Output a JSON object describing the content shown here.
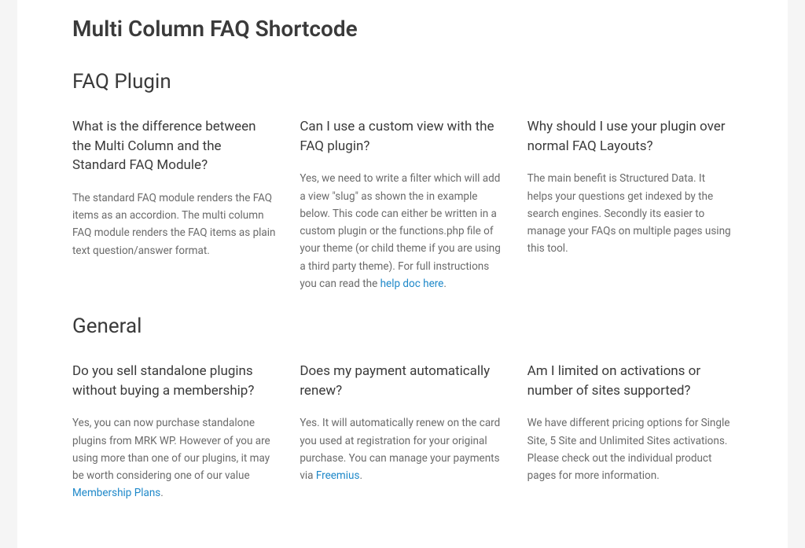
{
  "page": {
    "title": "Multi Column FAQ Shortcode"
  },
  "sections": [
    {
      "heading": "FAQ Plugin",
      "items": [
        {
          "question": "What is the difference between the Multi Column and the Standard FAQ Module?",
          "answer_before": "The standard FAQ module renders the FAQ items as an accordion. The multi column FAQ module renders the FAQ items as plain text question/answer format.",
          "link_text": "",
          "answer_after": ""
        },
        {
          "question": "Can I use a custom view with the FAQ plugin?",
          "answer_before": "Yes, we need to write a filter which will add a view \"slug\" as shown the in example below. This code can either be written in a custom plugin or the functions.php file of your theme (or child theme if you are using a third party theme). For full instructions you can read the ",
          "link_text": "help doc here",
          "answer_after": "."
        },
        {
          "question": "Why should I use your plugin over normal FAQ Layouts?",
          "answer_before": "The main benefit is Structured Data. It helps your questions get indexed by the search engines. Secondly its easier to manage your FAQs on multiple pages using this tool.",
          "link_text": "",
          "answer_after": ""
        }
      ]
    },
    {
      "heading": "General",
      "items": [
        {
          "question": "Do you sell standalone plugins without buying a membership?",
          "answer_before": "Yes, you can now purchase standalone plugins from MRK WP. However of you are using more than one of our plugins, it may be worth considering one of our value ",
          "link_text": "Membership Plans",
          "answer_after": "."
        },
        {
          "question": "Does my payment automatically renew?",
          "answer_before": "Yes. It will automatically renew on the card you used at registration for your original purchase. You can manage your payments via ",
          "link_text": "Freemius",
          "answer_after": "."
        },
        {
          "question": "Am I limited on activations or number of sites supported?",
          "answer_before": "We have different pricing options for Single Site, 5 Site and Unlimited Sites activations. Please check out the individual product pages for more information.",
          "link_text": "",
          "answer_after": ""
        }
      ]
    }
  ]
}
